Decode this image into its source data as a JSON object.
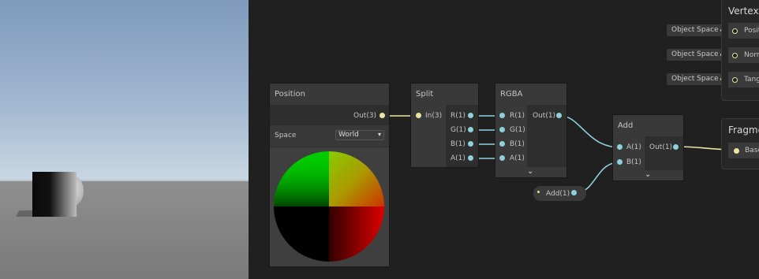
{
  "graph": {
    "position_node": {
      "title": "Position",
      "out_label": "Out(3)",
      "space_label": "Space",
      "space_value": "World"
    },
    "split_node": {
      "title": "Split",
      "in_label": "In(3)",
      "outputs": [
        "R(1)",
        "G(1)",
        "B(1)",
        "A(1)"
      ]
    },
    "rgba_node": {
      "title": "RGBA",
      "inputs": [
        "R(1)",
        "G(1)",
        "B(1)",
        "A(1)"
      ],
      "out_label": "Out(1)"
    },
    "add_node": {
      "title": "Add",
      "inputs": [
        "A(1)",
        "B(1)"
      ],
      "out_label": "Out(1)"
    },
    "add_property": {
      "label": "Add(1)"
    },
    "vertex_block": {
      "title": "Vertex",
      "rows": [
        "Positi",
        "Norm",
        "Tang"
      ],
      "space_labels": [
        "Object Space",
        "Object Space",
        "Object Space"
      ]
    },
    "fragment_block": {
      "title": "Fragme",
      "rows": [
        "Base"
      ]
    }
  },
  "colors": {
    "wire_blue": "#8ed1dc",
    "wire_yellow": "#e8e6a0",
    "node_body": "#2e2e2e",
    "node_header": "#393939"
  }
}
